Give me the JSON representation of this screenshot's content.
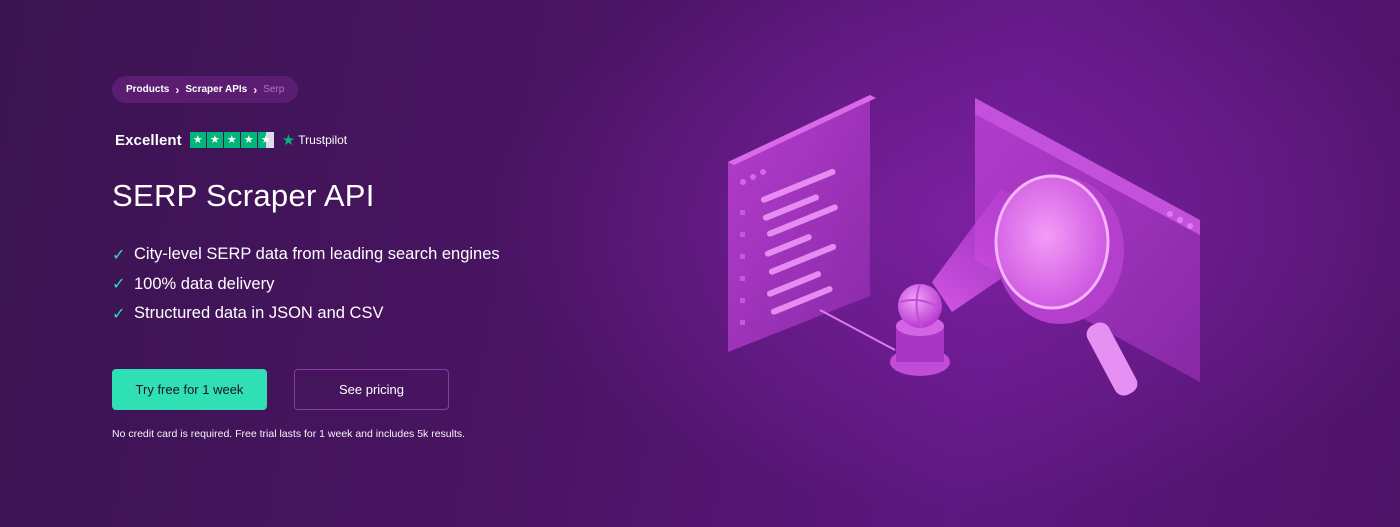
{
  "breadcrumb": {
    "items": [
      "Products",
      "Scraper APIs"
    ],
    "current": "Serp",
    "separator": ">"
  },
  "rating": {
    "label": "Excellent",
    "stars_filled": 4.5,
    "stars_total": 5,
    "provider": "Trustpilot"
  },
  "hero": {
    "title": "SERP Scraper API",
    "features": [
      "City-level SERP data from leading search engines",
      "100% data delivery",
      "Structured data in JSON and CSV"
    ]
  },
  "cta": {
    "primary_label": "Try free for 1 week",
    "secondary_label": "See pricing",
    "note": "No credit card is required. Free trial lasts for 1 week and includes 5k results."
  },
  "colors": {
    "accent": "#2ee0b3",
    "trustpilot_green": "#00b67a",
    "background": "#4a1463",
    "illustration_pink": "#d64be8"
  },
  "icons": [
    "chevron-right-icon",
    "check-icon",
    "trustpilot-star-icon",
    "magnifier-illustration"
  ]
}
